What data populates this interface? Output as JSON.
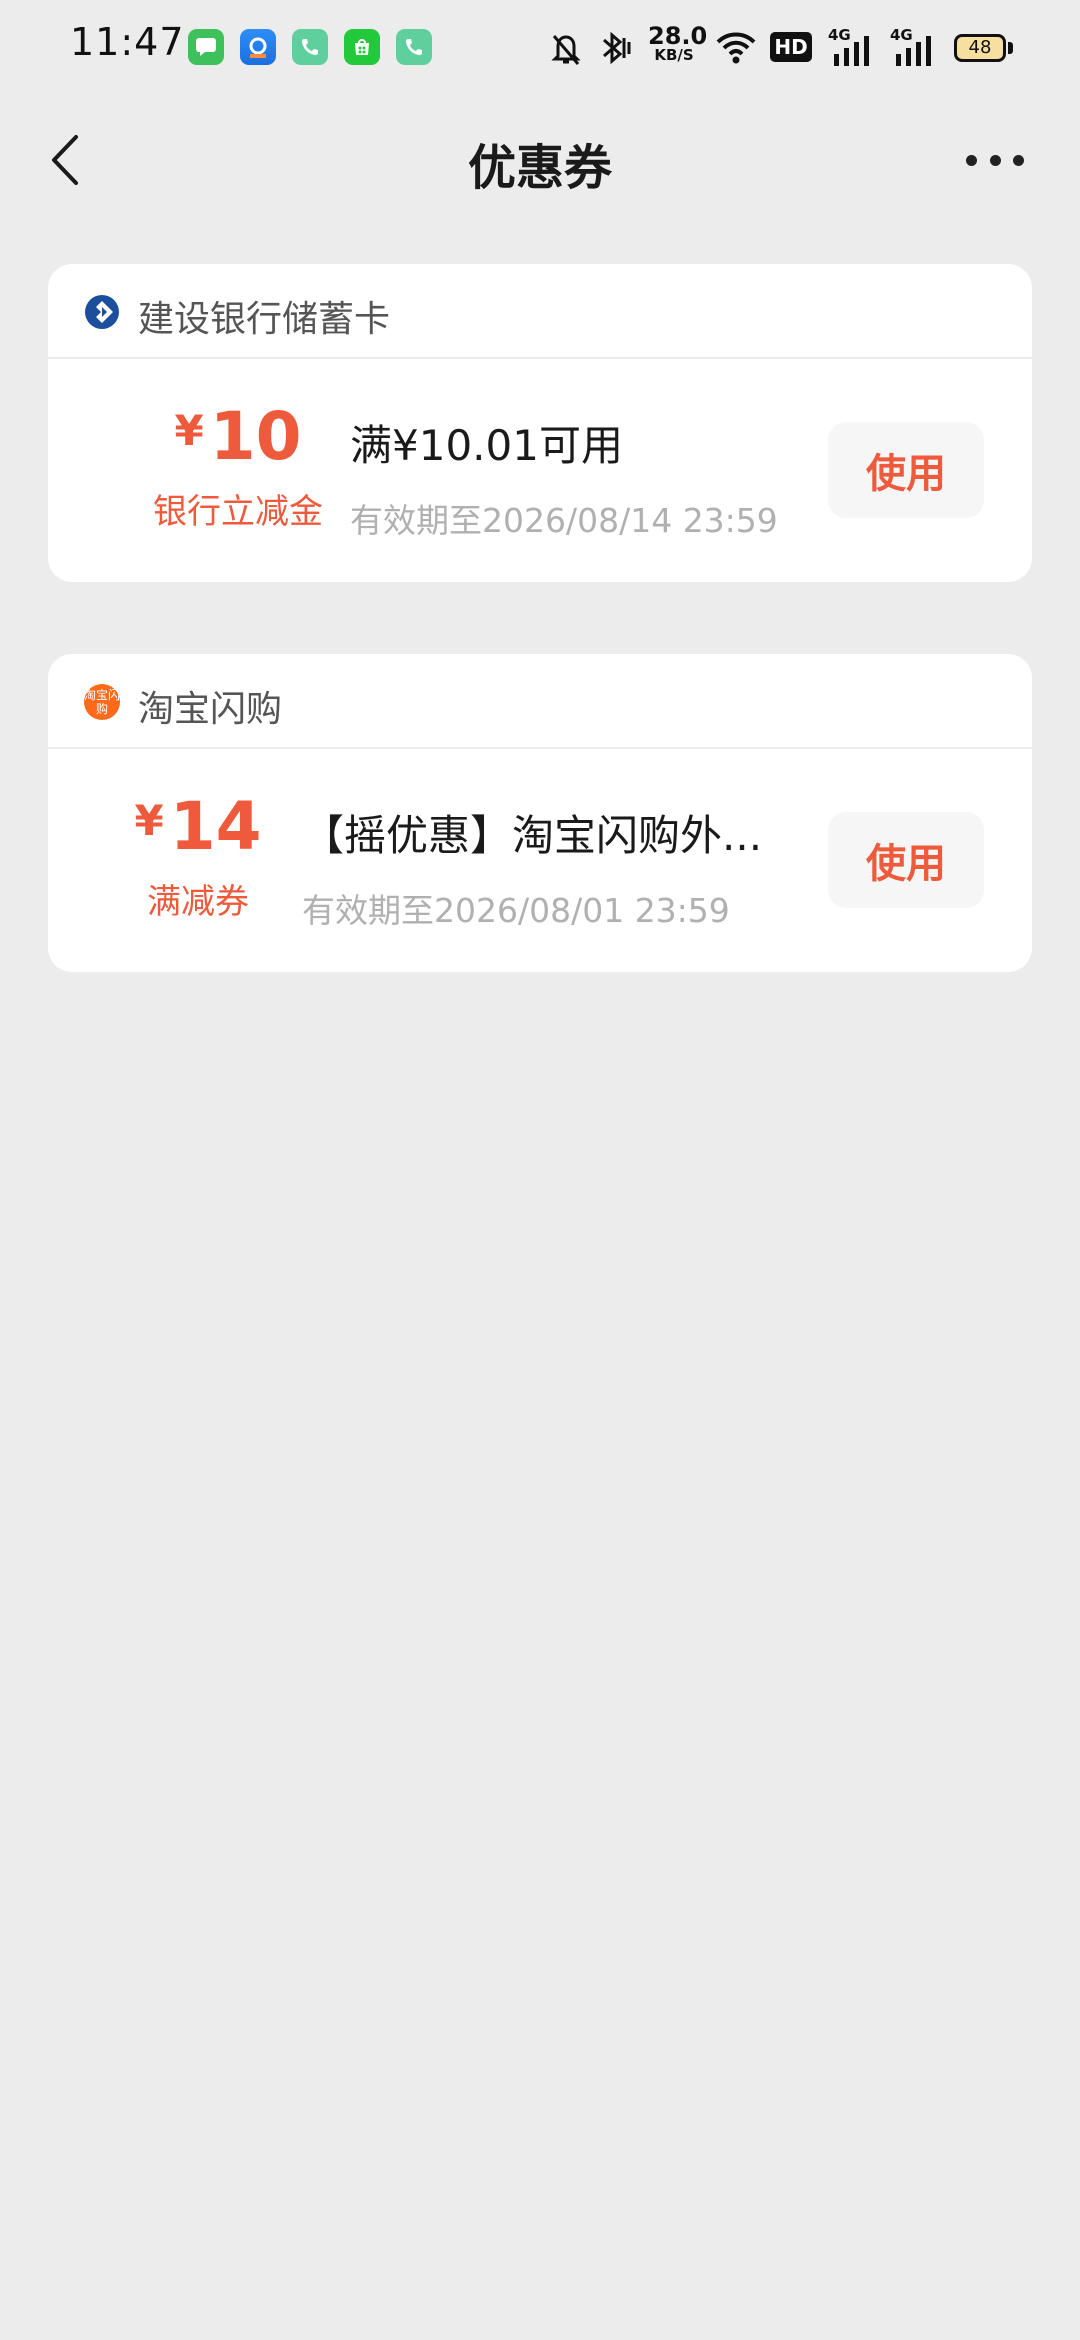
{
  "status_bar": {
    "time": "11:47",
    "notif_icons": [
      "messages-icon",
      "app-icon",
      "phone-icon",
      "app-store-icon",
      "phone-icon"
    ],
    "network_speed_value": "28.0",
    "network_speed_unit": "KB/S",
    "hd_label": "HD",
    "signal_label_1": "4G",
    "signal_label_2": "4G",
    "battery": "48"
  },
  "nav": {
    "title": "优惠券",
    "back_icon": "chevron-left-icon",
    "more_icon": "more-horizontal-icon"
  },
  "coupons": [
    {
      "issuer": "建设银行储蓄卡",
      "issuer_icon": "ccb-bank-icon",
      "currency": "¥",
      "amount": "10",
      "amount_type": "银行立减金",
      "condition": "满¥10.01可用",
      "validity": "有效期至2026/08/14 23:59",
      "action": "使用"
    },
    {
      "issuer": "淘宝闪购",
      "issuer_icon": "taobao-shangou-icon",
      "issuer_icon_text": "淘宝闪购",
      "currency": "¥",
      "amount": "14",
      "amount_type": "满减券",
      "condition": "【摇优惠】淘宝闪购外...",
      "validity": "有效期至2026/08/01 23:59",
      "action": "使用"
    }
  ],
  "colors": {
    "accent": "#ee5a3c",
    "background": "#ececec",
    "card": "#ffffff",
    "muted_text": "#b0b0b0"
  }
}
